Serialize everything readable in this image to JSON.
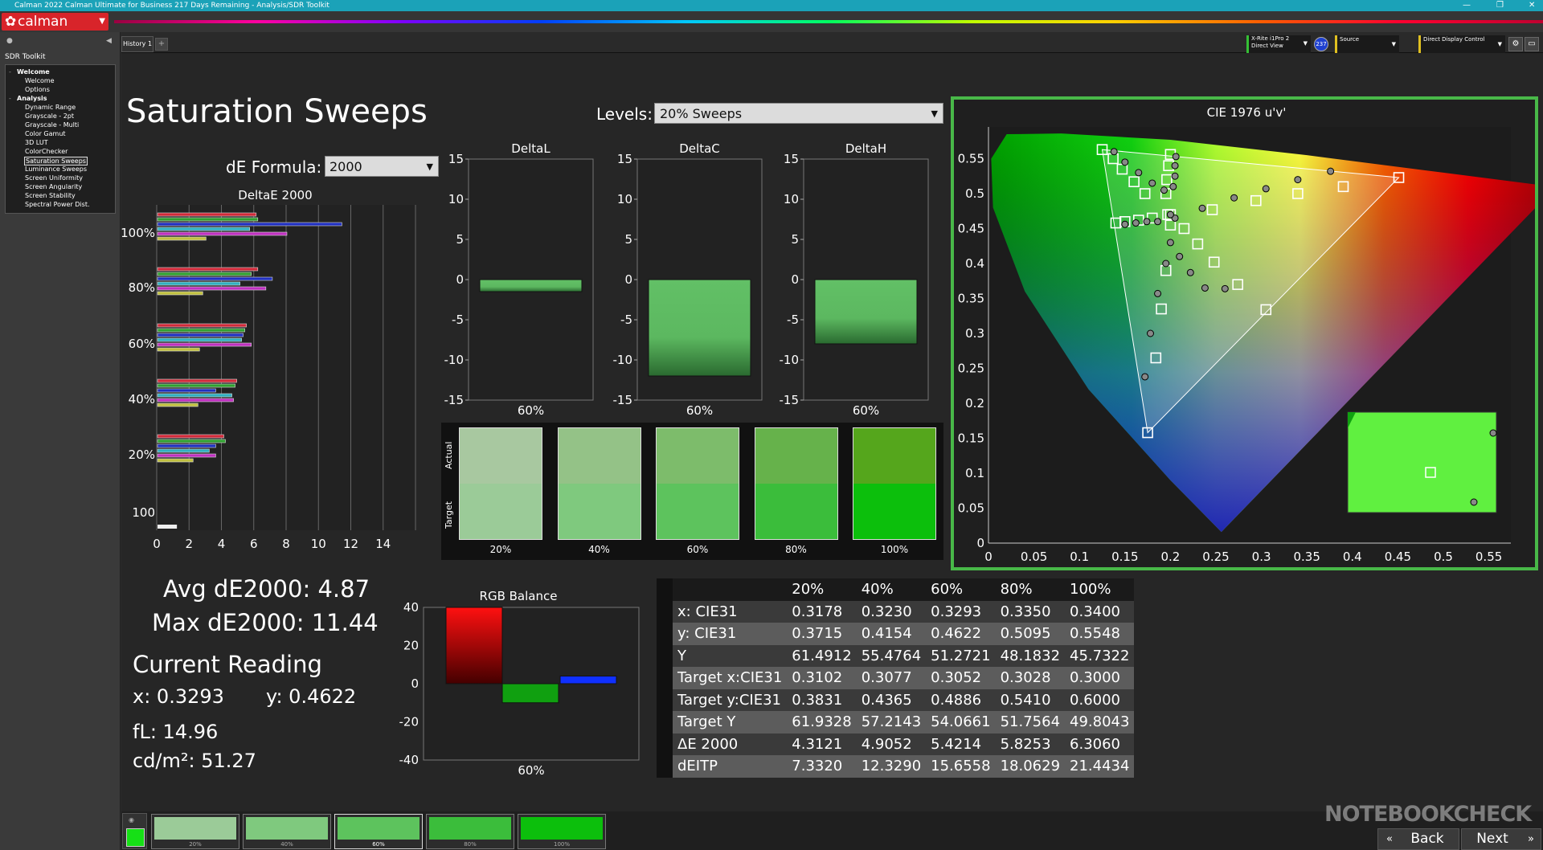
{
  "window": {
    "title": "Calman 2022 Calman Ultimate for Business 217 Days Remaining  - Analysis/SDR Toolkit"
  },
  "brand": {
    "logo": "calman"
  },
  "sidebar": {
    "workflow": "SDR Toolkit",
    "items": [
      "Welcome",
      "Welcome",
      "Options",
      "Analysis",
      "Dynamic Range",
      "Grayscale - 2pt",
      "Grayscale - Multi",
      "Color Gamut",
      "3D LUT",
      "ColorChecker",
      "Saturation Sweeps",
      "Luminance Sweeps",
      "Screen Uniformity",
      "Screen Angularity",
      "Screen Stability",
      "Spectral Power Dist."
    ]
  },
  "tabs": {
    "history": "History 1"
  },
  "devices": {
    "meter": "X-Rite i1Pro 2",
    "meter_mode": "Direct View",
    "meter_badge": "237",
    "source": "Source",
    "display": "Direct Display Control"
  },
  "page": {
    "title": "Saturation Sweeps",
    "levels_label": "Levels:",
    "levels_value": "20% Sweeps",
    "formula_label": "dE Formula:",
    "formula_value": "2000"
  },
  "deltae_chart": {
    "title": "DeltaE 2000",
    "xticks": [
      "0",
      "2",
      "4",
      "6",
      "8",
      "10",
      "12",
      "14"
    ],
    "groups": [
      "100%",
      "80%",
      "60%",
      "40%",
      "20%",
      "100"
    ]
  },
  "delta_charts": [
    {
      "title": "DeltaL",
      "yticks": [
        "15",
        "10",
        "5",
        "0",
        "-5",
        "-10",
        "-15"
      ],
      "value": -1.5,
      "xlabel": "60%"
    },
    {
      "title": "DeltaC",
      "yticks": [
        "15",
        "10",
        "5",
        "0",
        "-5",
        "-10",
        "-15"
      ],
      "value": -12,
      "xlabel": "60%"
    },
    {
      "title": "DeltaH",
      "yticks": [
        "15",
        "10",
        "5",
        "0",
        "-5",
        "-10",
        "-15"
      ],
      "value": -8,
      "xlabel": "60%"
    }
  ],
  "swatches": {
    "actual_label": "Actual",
    "target_label": "Target",
    "items": [
      {
        "label": "20%",
        "actual": "#a8c8a0",
        "target": "#9bcb98"
      },
      {
        "label": "40%",
        "actual": "#94c287",
        "target": "#7fc97e"
      },
      {
        "label": "60%",
        "actual": "#7dbc6b",
        "target": "#5dc35d"
      },
      {
        "label": "80%",
        "actual": "#66b24b",
        "target": "#3bbd3b"
      },
      {
        "label": "100%",
        "actual": "#55a61c",
        "target": "#0cbf0c"
      }
    ]
  },
  "summary": {
    "avg": "Avg dE2000: 4.87",
    "max": "Max dE2000: 11.44",
    "current_heading": "Current Reading",
    "x": "x: 0.3293",
    "y": "y: 0.4622",
    "fl": "fL: 14.96",
    "cdm2": "cd/m²: 51.27"
  },
  "rgb_balance": {
    "title": "RGB Balance",
    "yticks": [
      "40",
      "20",
      "0",
      "-20",
      "-40"
    ],
    "xlabel": "60%",
    "values": {
      "r": 40,
      "g": -10,
      "b": 4
    },
    "colors": {
      "r": "#ff1010",
      "g": "#10a010",
      "b": "#1030ff"
    }
  },
  "cie": {
    "title": "CIE 1976 u'v'",
    "xticks": [
      "0",
      "0.05",
      "0.1",
      "0.15",
      "0.2",
      "0.25",
      "0.3",
      "0.35",
      "0.4",
      "0.45",
      "0.5",
      "0.55"
    ],
    "yticks": [
      "0.55",
      "0.5",
      "0.45",
      "0.4",
      "0.35",
      "0.3",
      "0.25",
      "0.2",
      "0.15",
      "0.1",
      "0.05",
      "0"
    ]
  },
  "results": {
    "columns": [
      "",
      "20%",
      "40%",
      "60%",
      "80%",
      "100%"
    ],
    "rows": [
      [
        "x: CIE31",
        "0.3178",
        "0.3230",
        "0.3293",
        "0.3350",
        "0.3400"
      ],
      [
        "y: CIE31",
        "0.3715",
        "0.4154",
        "0.4622",
        "0.5095",
        "0.5548"
      ],
      [
        "Y",
        "61.4912",
        "55.4764",
        "51.2721",
        "48.1832",
        "45.7322"
      ],
      [
        "Target x:CIE31",
        "0.3102",
        "0.3077",
        "0.3052",
        "0.3028",
        "0.3000"
      ],
      [
        "Target y:CIE31",
        "0.3831",
        "0.4365",
        "0.4886",
        "0.5410",
        "0.6000"
      ],
      [
        "Target Y",
        "61.9328",
        "57.2143",
        "54.0661",
        "51.7564",
        "49.8043"
      ],
      [
        "ΔE 2000",
        "4.3121",
        "4.9052",
        "5.4214",
        "5.8253",
        "6.3060"
      ],
      [
        "dEITP",
        "7.3320",
        "12.3290",
        "15.6558",
        "18.0629",
        "21.4434"
      ]
    ]
  },
  "thumbs": [
    "20%",
    "40%",
    "60%",
    "80%",
    "100%"
  ],
  "nav": {
    "back": "Back",
    "next": "Next"
  },
  "watermark": "NOTEBOOKCHECK"
}
